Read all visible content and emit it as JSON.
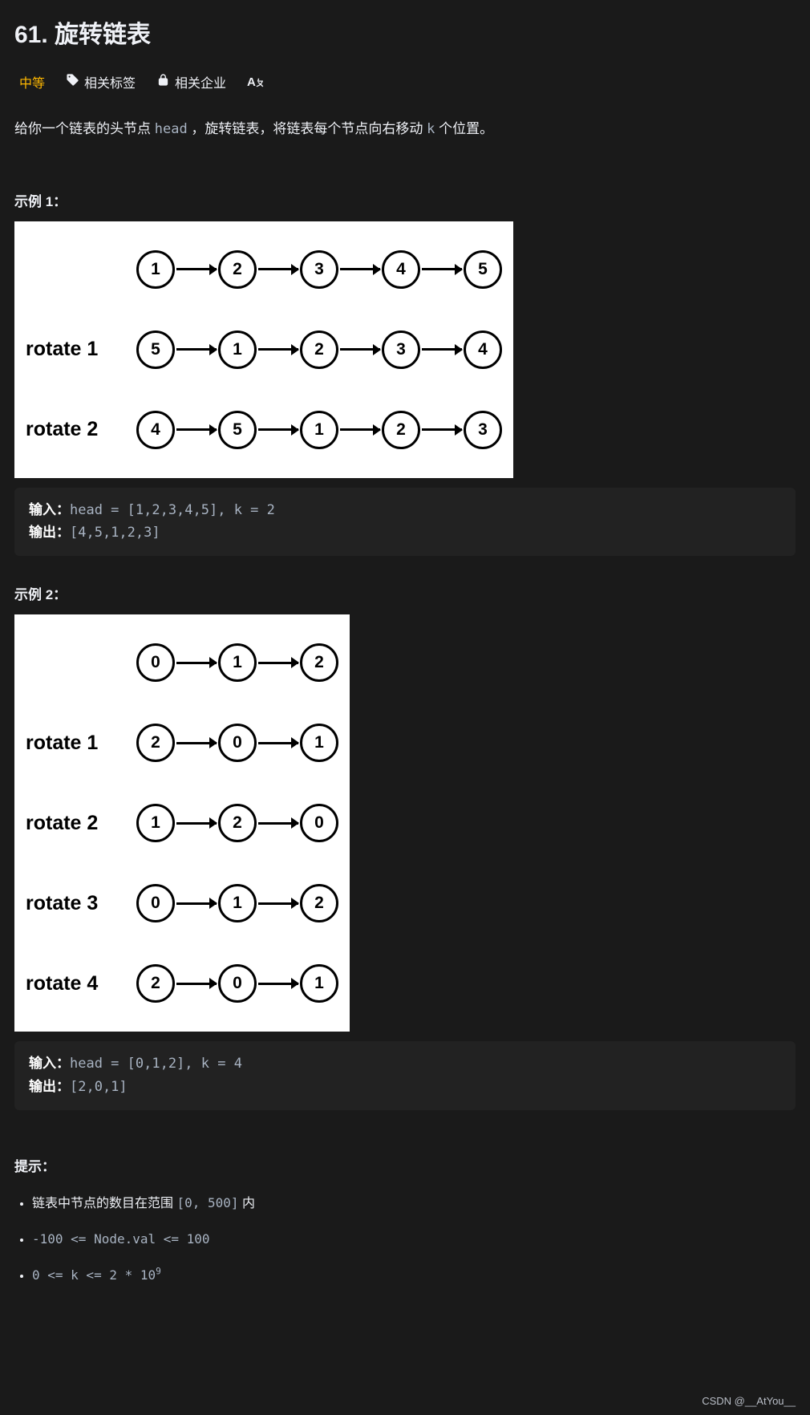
{
  "title": "61. 旋转链表",
  "difficulty": "中等",
  "meta": {
    "tags": "相关标签",
    "companies": "相关企业",
    "translate_icon": "Aㄆ"
  },
  "description": {
    "pre": "给你一个链表的头节点 ",
    "code1": "head",
    "mid": " ，旋转链表，将链表每个节点向右移动 ",
    "code2": "k",
    "post": " 个位置。"
  },
  "example1": {
    "label": "示例 1：",
    "diagram": {
      "rows": [
        {
          "label": "",
          "nodes": [
            "1",
            "2",
            "3",
            "4",
            "5"
          ]
        },
        {
          "label": "rotate 1",
          "nodes": [
            "5",
            "1",
            "2",
            "3",
            "4"
          ]
        },
        {
          "label": "rotate 2",
          "nodes": [
            "4",
            "5",
            "1",
            "2",
            "3"
          ]
        }
      ]
    },
    "input_label": "输入：",
    "input": "head = [1,2,3,4,5], k = 2",
    "output_label": "输出：",
    "output": "[4,5,1,2,3]"
  },
  "example2": {
    "label": "示例 2：",
    "diagram": {
      "rows": [
        {
          "label": "",
          "nodes": [
            "0",
            "1",
            "2"
          ]
        },
        {
          "label": "rotate 1",
          "nodes": [
            "2",
            "0",
            "1"
          ]
        },
        {
          "label": "rotate 2",
          "nodes": [
            "1",
            "2",
            "0"
          ]
        },
        {
          "label": "rotate 3",
          "nodes": [
            "0",
            "1",
            "2"
          ]
        },
        {
          "label": "rotate 4",
          "nodes": [
            "2",
            "0",
            "1"
          ]
        }
      ]
    },
    "input_label": "输入：",
    "input": "head = [0,1,2], k = 4",
    "output_label": "输出：",
    "output": "[2,0,1]"
  },
  "hints": {
    "label": "提示：",
    "items": [
      {
        "pre": "链表中节点的数目在范围 ",
        "code": "[0, 500]",
        "post": " 内"
      },
      {
        "pre": "",
        "code": "-100 <= Node.val <= 100",
        "post": ""
      },
      {
        "pre": "",
        "code_html": "0 <= k <= 2 * 10<span class='sup'>9</span>",
        "post": ""
      }
    ]
  },
  "watermark": "CSDN @__AtYou__"
}
